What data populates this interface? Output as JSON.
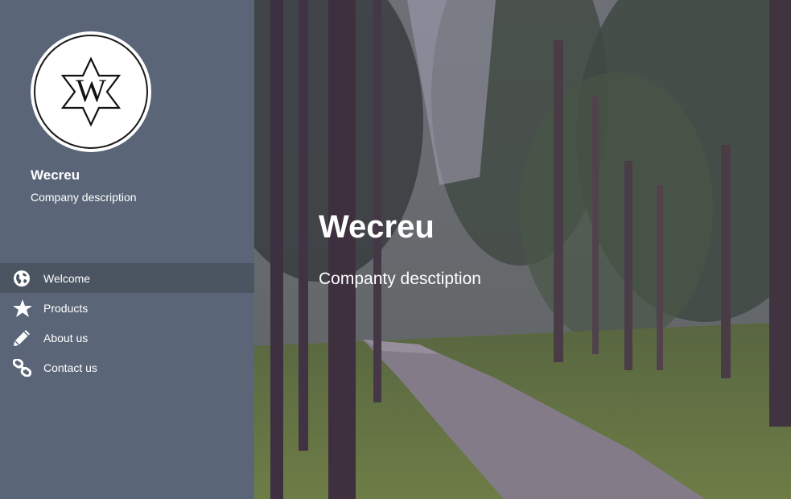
{
  "sidebar": {
    "logo_letter": "W",
    "brand_name": "Wecreu",
    "brand_description": "Company description",
    "nav": [
      {
        "label": "Welcome",
        "icon": "globe-icon",
        "active": true
      },
      {
        "label": "Products",
        "icon": "star-icon",
        "active": false
      },
      {
        "label": "About us",
        "icon": "pencil-icon",
        "active": false
      },
      {
        "label": "Contact us",
        "icon": "link-icon",
        "active": false
      }
    ]
  },
  "hero": {
    "title": "Wecreu",
    "subtitle": "Companty desctiption"
  },
  "colors": {
    "sidebar_bg": "#5a6678",
    "active_nav_bg": "#4b5562",
    "text": "#ffffff"
  }
}
